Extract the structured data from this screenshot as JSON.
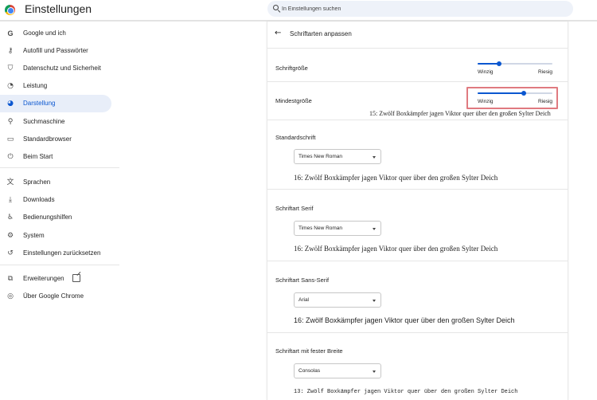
{
  "header": {
    "app_title": "Einstellungen",
    "search_placeholder": "In Einstellungen suchen"
  },
  "sidebar": {
    "items": [
      {
        "label": "Google und ich",
        "icon": "google-icon"
      },
      {
        "label": "Autofill und Passwörter",
        "icon": "key-icon"
      },
      {
        "label": "Datenschutz und Sicherheit",
        "icon": "shield-icon"
      },
      {
        "label": "Leistung",
        "icon": "speedometer-icon"
      },
      {
        "label": "Darstellung",
        "icon": "palette-icon",
        "active": true
      },
      {
        "label": "Suchmaschine",
        "icon": "search-icon"
      },
      {
        "label": "Standardbrowser",
        "icon": "browser-window-icon"
      },
      {
        "label": "Beim Start",
        "icon": "power-icon"
      },
      {
        "label": "Sprachen",
        "icon": "translate-icon"
      },
      {
        "label": "Downloads",
        "icon": "download-icon"
      },
      {
        "label": "Bedienungshilfen",
        "icon": "accessibility-icon"
      },
      {
        "label": "System",
        "icon": "wrench-icon"
      },
      {
        "label": "Einstellungen zurücksetzen",
        "icon": "reset-icon"
      },
      {
        "label": "Erweiterungen",
        "icon": "puzzle-icon"
      },
      {
        "label": "Über Google Chrome",
        "icon": "chrome-icon"
      }
    ]
  },
  "main": {
    "page_title": "Schriftarten anpassen",
    "font_size": {
      "label": "Schriftgröße",
      "min_label": "Winzig",
      "max_label": "Riesig",
      "value_fraction": 0.29
    },
    "min_font_size": {
      "label": "Mindestgröße",
      "min_label": "Winzig",
      "max_label": "Riesig",
      "value_fraction": 0.62,
      "sample": "15: Zwölf Boxkämpfer jagen Viktor quer über den großen Sylter Deich"
    },
    "standard_font": {
      "label": "Standardschrift",
      "selected": "Times New Roman",
      "sample": "16: Zwölf Boxkämpfer jagen Viktor quer über den großen Sylter Deich"
    },
    "serif_font": {
      "label": "Schriftart Serif",
      "selected": "Times New Roman",
      "sample": "16: Zwölf Boxkämpfer jagen Viktor quer über den großen Sylter Deich"
    },
    "sans_serif_font": {
      "label": "Schriftart Sans-Serif",
      "selected": "Arial",
      "sample": "16: Zwölf Boxkämpfer jagen Viktor quer über den großen Sylter Deich"
    },
    "fixed_width_font": {
      "label": "Schriftart mit fester Breite",
      "selected": "Consolas",
      "sample": "13: Zwölf Boxkämpfer jagen Viktor quer über den großen Sylter Deich"
    }
  },
  "colors": {
    "accent": "#0b57d0",
    "active_nav_bg": "#e8eef9",
    "highlight_outline": "#e07a80"
  }
}
